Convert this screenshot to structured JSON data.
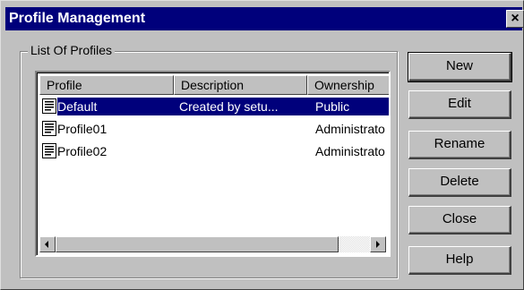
{
  "window": {
    "title": "Profile Management",
    "close_glyph": "×"
  },
  "group": {
    "label": "List Of Profiles"
  },
  "list": {
    "columns": [
      "Profile",
      "Description",
      "Ownership"
    ],
    "rows": [
      {
        "profile": "Default",
        "description": "Created by setu...",
        "ownership": "Public",
        "selected": true,
        "icon": "profile-document-icon"
      },
      {
        "profile": "Profile01",
        "description": "",
        "ownership": "Administrato",
        "selected": false,
        "icon": "profile-document-icon"
      },
      {
        "profile": "Profile02",
        "description": "",
        "ownership": "Administrato",
        "selected": false,
        "icon": "profile-document-icon"
      }
    ]
  },
  "buttons": {
    "new": "New",
    "edit": "Edit",
    "rename": "Rename",
    "delete": "Delete",
    "close": "Close",
    "help": "Help"
  },
  "colors": {
    "titlebar": "#00007b",
    "selection": "#00007b",
    "face": "#c0c0c0"
  }
}
